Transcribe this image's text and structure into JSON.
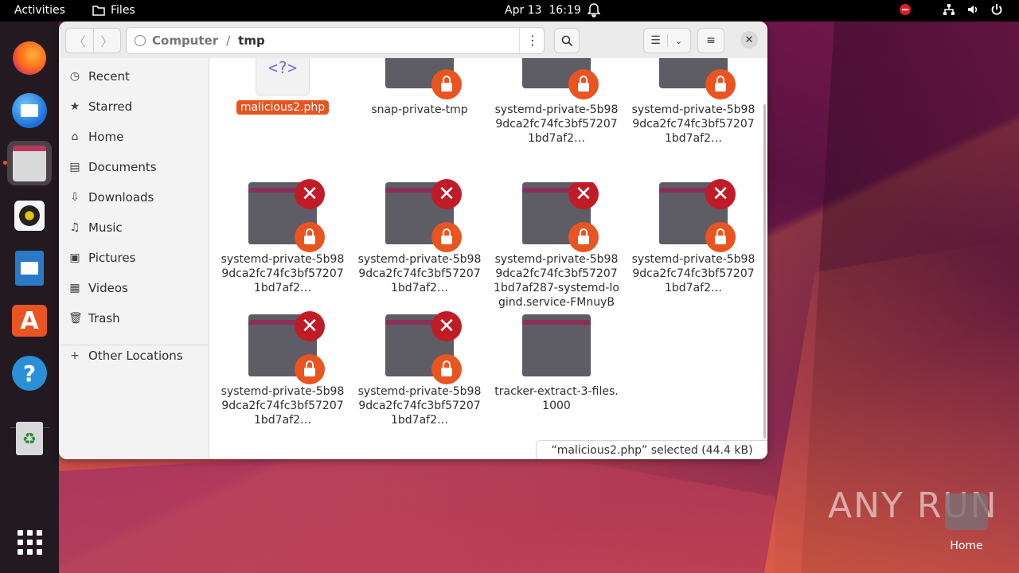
{
  "topbar": {
    "activities": "Activities",
    "app_name": "Files",
    "date": "Apr 13",
    "time": "16:19"
  },
  "dock": {
    "items": [
      "firefox-icon",
      "thunderbird-icon",
      "files-icon",
      "rhythmbox-icon",
      "libreoffice-writer-icon",
      "app-center-icon",
      "help-icon",
      "trash-icon",
      "show-apps-icon"
    ]
  },
  "window": {
    "path": [
      "Computer",
      "tmp"
    ],
    "sidebar": {
      "items": [
        {
          "label": "Recent",
          "icon": "clock-icon"
        },
        {
          "label": "Starred",
          "icon": "star-icon"
        },
        {
          "label": "Home",
          "icon": "home-icon"
        },
        {
          "label": "Documents",
          "icon": "document-icon"
        },
        {
          "label": "Downloads",
          "icon": "download-icon"
        },
        {
          "label": "Music",
          "icon": "music-icon"
        },
        {
          "label": "Pictures",
          "icon": "picture-icon"
        },
        {
          "label": "Videos",
          "icon": "video-icon"
        },
        {
          "label": "Trash",
          "icon": "trash-icon"
        }
      ],
      "other_locations": "Other Locations"
    },
    "files": [
      {
        "name": "malicious2.php",
        "type": "php",
        "selected": true
      },
      {
        "name": "snap-private-tmp",
        "type": "folder-locked"
      },
      {
        "name": "systemd-private-5b989dca2fc74fc3bf572071bd7af2…",
        "type": "folder-locked"
      },
      {
        "name": "systemd-private-5b989dca2fc74fc3bf572071bd7af2…",
        "type": "folder-locked"
      },
      {
        "name": "systemd-private-5b989dca2fc74fc3bf572071bd7af2…",
        "type": "folder-denied"
      },
      {
        "name": "systemd-private-5b989dca2fc74fc3bf572071bd7af2…",
        "type": "folder-denied"
      },
      {
        "name": "systemd-private-5b989dca2fc74fc3bf572071bd7af287-systemd-logind.service-FMnuyB",
        "type": "folder-denied"
      },
      {
        "name": "systemd-private-5b989dca2fc74fc3bf572071bd7af2…",
        "type": "folder-denied"
      },
      {
        "name": "systemd-private-5b989dca2fc74fc3bf572071bd7af2…",
        "type": "folder-denied"
      },
      {
        "name": "systemd-private-5b989dca2fc74fc3bf572071bd7af2…",
        "type": "folder-denied"
      },
      {
        "name": "tracker-extract-3-files.1000",
        "type": "folder"
      }
    ],
    "status": "“malicious2.php” selected (44.4 kB)"
  },
  "desktop": {
    "watermark": "ANY RUN",
    "home_label": "Home"
  },
  "colors": {
    "accent": "#e95420",
    "folder_tab": "#8a2f58",
    "folder_body": "#5e5c64",
    "deny": "#c01c28"
  }
}
